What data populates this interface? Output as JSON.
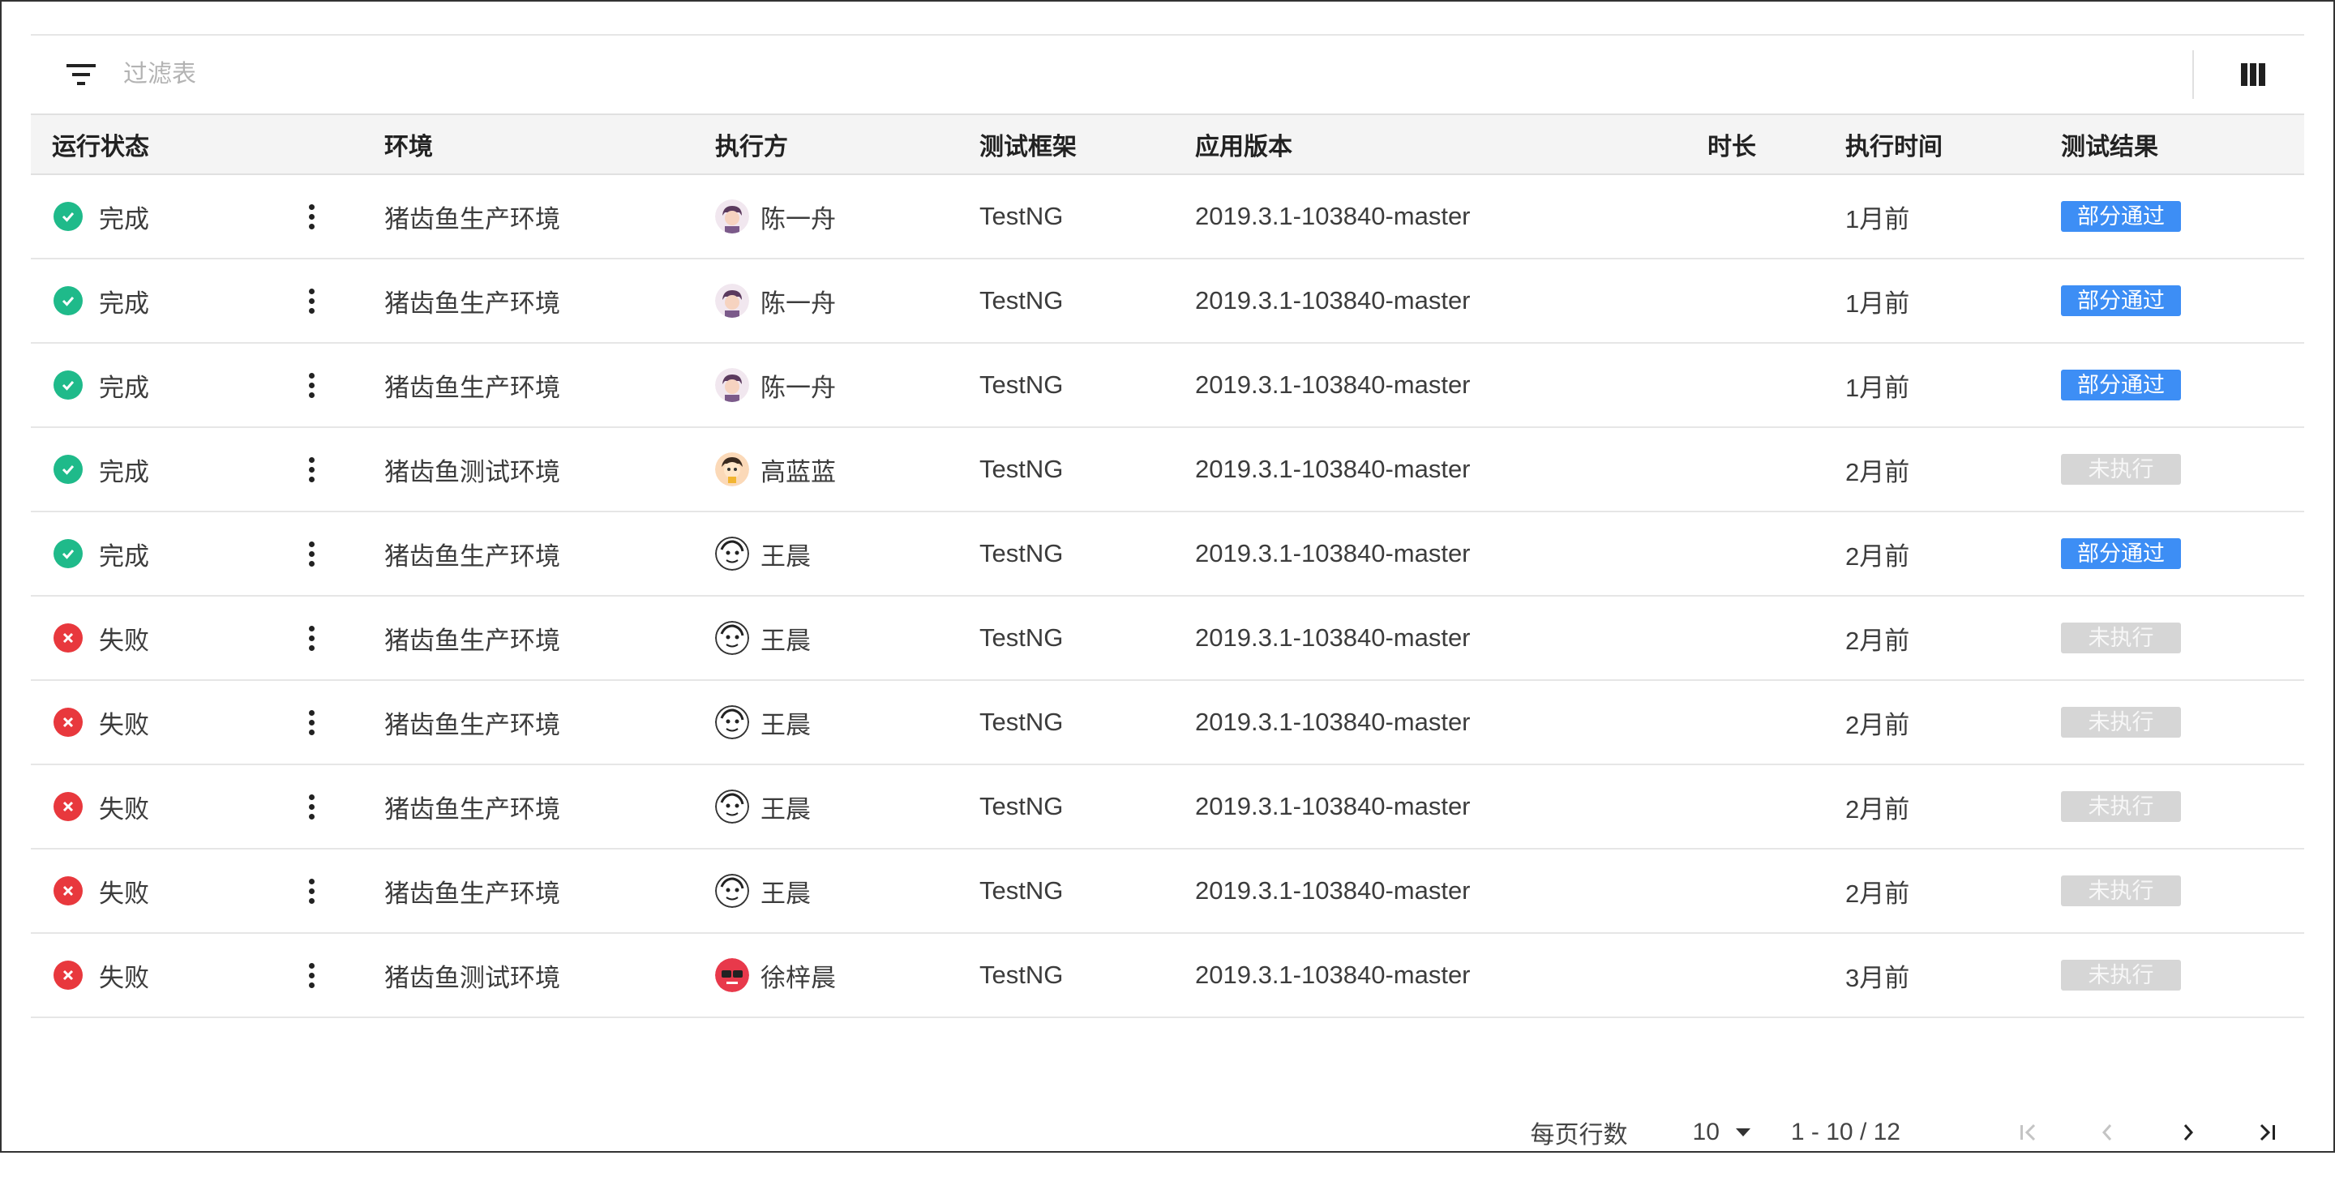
{
  "toolbar": {
    "filter_placeholder": "过滤表",
    "filter_icon": "filter-icon",
    "columns_icon": "view-columns-icon"
  },
  "table": {
    "headers": {
      "status": "运行状态",
      "environment": "环境",
      "executor": "执行方",
      "framework": "测试框架",
      "version": "应用版本",
      "duration": "时长",
      "exec_time": "执行时间",
      "result": "测试结果"
    },
    "rows": [
      {
        "status": "完成",
        "state": "ok",
        "environment": "猪齿鱼生产环境",
        "executor": "陈一舟",
        "framework": "TestNG",
        "version": "2019.3.1-103840-master",
        "duration": "",
        "exec_time": "1月前",
        "result": "部分通过",
        "result_type": "pass"
      },
      {
        "status": "完成",
        "state": "ok",
        "environment": "猪齿鱼生产环境",
        "executor": "陈一舟",
        "framework": "TestNG",
        "version": "2019.3.1-103840-master",
        "duration": "",
        "exec_time": "1月前",
        "result": "部分通过",
        "result_type": "pass"
      },
      {
        "status": "完成",
        "state": "ok",
        "environment": "猪齿鱼生产环境",
        "executor": "陈一舟",
        "framework": "TestNG",
        "version": "2019.3.1-103840-master",
        "duration": "",
        "exec_time": "1月前",
        "result": "部分通过",
        "result_type": "pass"
      },
      {
        "status": "完成",
        "state": "ok",
        "environment": "猪齿鱼测试环境",
        "executor": "高蓝蓝",
        "framework": "TestNG",
        "version": "2019.3.1-103840-master",
        "duration": "",
        "exec_time": "2月前",
        "result": "未执行",
        "result_type": "none"
      },
      {
        "status": "完成",
        "state": "ok",
        "environment": "猪齿鱼生产环境",
        "executor": "王晨",
        "framework": "TestNG",
        "version": "2019.3.1-103840-master",
        "duration": "",
        "exec_time": "2月前",
        "result": "部分通过",
        "result_type": "pass"
      },
      {
        "status": "失败",
        "state": "fail",
        "environment": "猪齿鱼生产环境",
        "executor": "王晨",
        "framework": "TestNG",
        "version": "2019.3.1-103840-master",
        "duration": "",
        "exec_time": "2月前",
        "result": "未执行",
        "result_type": "none"
      },
      {
        "status": "失败",
        "state": "fail",
        "environment": "猪齿鱼生产环境",
        "executor": "王晨",
        "framework": "TestNG",
        "version": "2019.3.1-103840-master",
        "duration": "",
        "exec_time": "2月前",
        "result": "未执行",
        "result_type": "none"
      },
      {
        "status": "失败",
        "state": "fail",
        "environment": "猪齿鱼生产环境",
        "executor": "王晨",
        "framework": "TestNG",
        "version": "2019.3.1-103840-master",
        "duration": "",
        "exec_time": "2月前",
        "result": "未执行",
        "result_type": "none"
      },
      {
        "status": "失败",
        "state": "fail",
        "environment": "猪齿鱼生产环境",
        "executor": "王晨",
        "framework": "TestNG",
        "version": "2019.3.1-103840-master",
        "duration": "",
        "exec_time": "2月前",
        "result": "未执行",
        "result_type": "none"
      },
      {
        "status": "失败",
        "state": "fail",
        "environment": "猪齿鱼测试环境",
        "executor": "徐梓晨",
        "framework": "TestNG",
        "version": "2019.3.1-103840-master",
        "duration": "",
        "exec_time": "3月前",
        "result": "未执行",
        "result_type": "none"
      }
    ]
  },
  "pagination": {
    "rows_per_page_label": "每页行数",
    "rows_per_page_value": "10",
    "range": "1 - 10 / 12"
  },
  "colors": {
    "ok": "#1fba8a",
    "fail": "#e8383d",
    "pass_badge": "#3d8ef5",
    "none_badge": "#d6d6d6"
  }
}
